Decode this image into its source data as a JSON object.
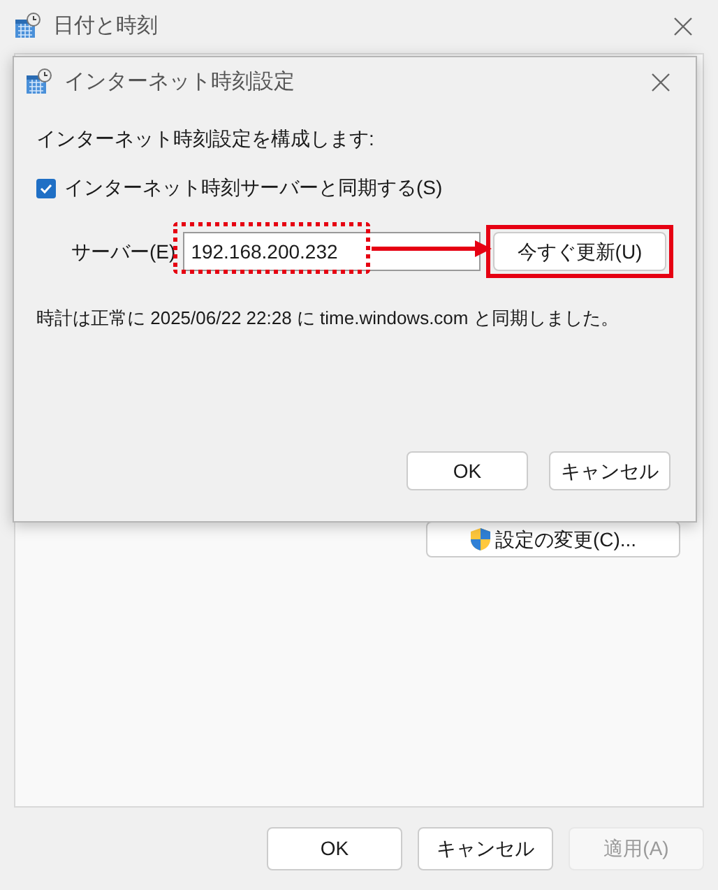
{
  "window": {
    "title": "日付と時刻",
    "change_settings_button": "設定の変更(C)...",
    "buttons": [
      {
        "label": "OK",
        "disabled": false
      },
      {
        "label": "キャンセル",
        "disabled": false
      },
      {
        "label": "適用(A)",
        "disabled": true
      }
    ]
  },
  "dialog": {
    "title": "インターネット時刻設定",
    "heading": "インターネット時刻設定を構成します:",
    "sync_checkbox": {
      "label": "インターネット時刻サーバーと同期する(S)",
      "checked": true
    },
    "server": {
      "label": "サーバー(E)",
      "value": "192.168.200.232"
    },
    "update_button": "今すぐ更新(U)",
    "status": "時計は正常に 2025/06/22 22:28 に time.windows.com と同期しました。",
    "buttons": [
      "OK",
      "キャンセル"
    ]
  }
}
